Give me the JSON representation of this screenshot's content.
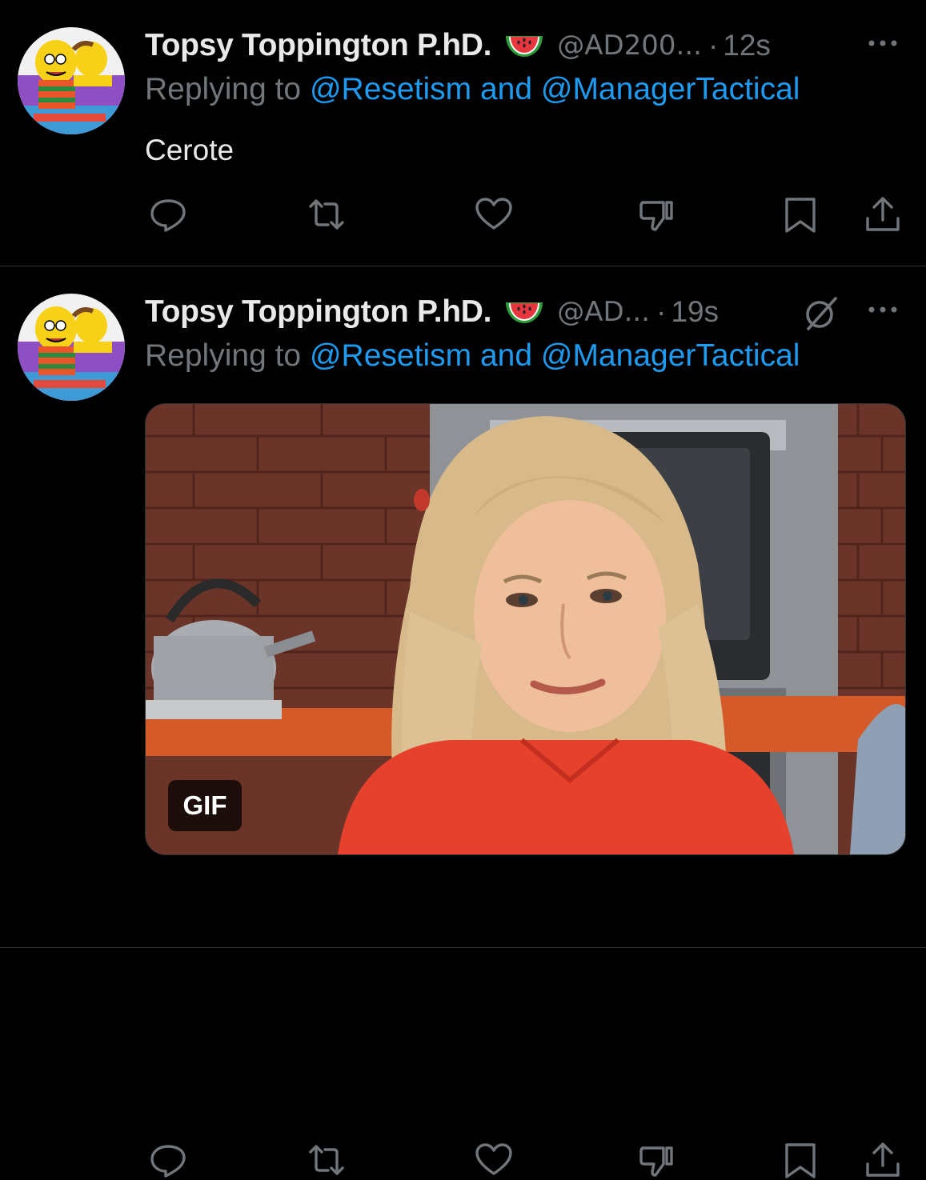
{
  "tweets": [
    {
      "name": "Topsy Toppington P.hD.",
      "handle": "@AD200...",
      "dot": "·",
      "time": "12s",
      "replying_prefix": "Replying to",
      "mention1": "@Resetism",
      "and": "and",
      "mention2": "@ManagerTactical",
      "text": "Cerote"
    },
    {
      "name": "Topsy Toppington P.hD.",
      "handle": "@AD...",
      "dot": "·",
      "time": "19s",
      "replying_prefix": "Replying to",
      "mention1": "@Resetism",
      "and": "and",
      "mention2": "@ManagerTactical",
      "media_badge": "GIF"
    }
  ],
  "icons": {
    "avatar": "simpsons-avatar",
    "emoji": "watermelon-emoji",
    "more": "more-dots-icon",
    "grok": "grok-icon",
    "reply": "reply-icon",
    "retweet": "retweet-icon",
    "like": "heart-icon",
    "dislike": "dislike-icon",
    "bookmark": "bookmark-icon",
    "share": "share-icon"
  },
  "colors": {
    "background": "#000000",
    "text": "#e7e9ea",
    "muted": "#71767b",
    "link": "#1d9bf0",
    "divider": "#2f3336"
  }
}
